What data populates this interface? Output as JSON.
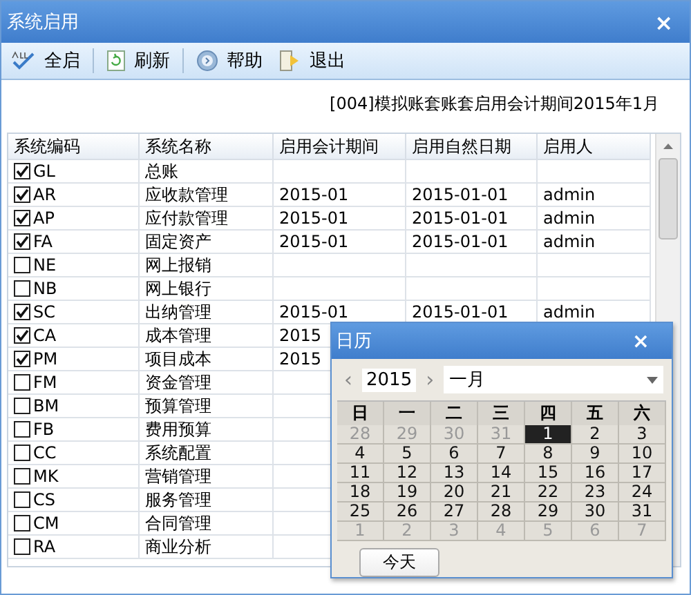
{
  "window": {
    "title": "系统启用",
    "close": "×"
  },
  "toolbar": [
    {
      "label": "全启"
    },
    {
      "label": "刷新"
    },
    {
      "label": "帮助"
    },
    {
      "label": "退出"
    }
  ],
  "info": "[004]模拟账套账套启用会计期间2015年1月",
  "table": {
    "columns": [
      "系统编码",
      "系统名称",
      "启用会计期间",
      "启用自然日期",
      "启用人"
    ],
    "rows": [
      {
        "code": "GL",
        "name": "总账",
        "checked": true
      },
      {
        "code": "AR",
        "name": "应收款管理",
        "checked": true,
        "period": "2015-01",
        "date": "2015-01-01",
        "user": "admin"
      },
      {
        "code": "AP",
        "name": "应付款管理",
        "checked": true,
        "period": "2015-01",
        "date": "2015-01-01",
        "user": "admin"
      },
      {
        "code": "FA",
        "name": "固定资产",
        "checked": true,
        "period": "2015-01",
        "date": "2015-01-01",
        "user": "admin"
      },
      {
        "code": "NE",
        "name": "网上报销",
        "checked": false
      },
      {
        "code": "NB",
        "name": "网上银行",
        "checked": false
      },
      {
        "code": "SC",
        "name": "出纳管理",
        "checked": true,
        "period": "2015-01",
        "date": "2015-01-01",
        "user": "admin"
      },
      {
        "code": "CA",
        "name": "成本管理",
        "checked": true,
        "period": "2015"
      },
      {
        "code": "PM",
        "name": "项目成本",
        "checked": true,
        "period": "2015"
      },
      {
        "code": "FM",
        "name": "资金管理",
        "checked": false
      },
      {
        "code": "BM",
        "name": "预算管理",
        "checked": false
      },
      {
        "code": "FB",
        "name": "费用预算",
        "checked": false
      },
      {
        "code": "CC",
        "name": "系统配置",
        "checked": false
      },
      {
        "code": "MK",
        "name": "营销管理",
        "checked": false
      },
      {
        "code": "CS",
        "name": "服务管理",
        "checked": false
      },
      {
        "code": "CM",
        "name": "合同管理",
        "checked": false
      },
      {
        "code": "RA",
        "name": "商业分析",
        "checked": false
      }
    ]
  },
  "calendar": {
    "title": "日历",
    "close": "×",
    "prev": "‹",
    "year": "2015",
    "next": "›",
    "month": "一月",
    "weekdays": [
      "日",
      "一",
      "二",
      "三",
      "四",
      "五",
      "六"
    ],
    "days": [
      {
        "label": "28",
        "other": true,
        "selected": false
      },
      {
        "label": "29",
        "other": true,
        "selected": false
      },
      {
        "label": "30",
        "other": true,
        "selected": false
      },
      {
        "label": "31",
        "other": true,
        "selected": false
      },
      {
        "label": "1",
        "other": false,
        "selected": true
      },
      {
        "label": "2",
        "other": false,
        "selected": false
      },
      {
        "label": "3",
        "other": false,
        "selected": false
      },
      {
        "label": "4",
        "other": false,
        "selected": false
      },
      {
        "label": "5",
        "other": false,
        "selected": false
      },
      {
        "label": "6",
        "other": false,
        "selected": false
      },
      {
        "label": "7",
        "other": false,
        "selected": false
      },
      {
        "label": "8",
        "other": false,
        "selected": false
      },
      {
        "label": "9",
        "other": false,
        "selected": false
      },
      {
        "label": "10",
        "other": false,
        "selected": false
      },
      {
        "label": "11",
        "other": false,
        "selected": false
      },
      {
        "label": "12",
        "other": false,
        "selected": false
      },
      {
        "label": "13",
        "other": false,
        "selected": false
      },
      {
        "label": "14",
        "other": false,
        "selected": false
      },
      {
        "label": "15",
        "other": false,
        "selected": false
      },
      {
        "label": "16",
        "other": false,
        "selected": false
      },
      {
        "label": "17",
        "other": false,
        "selected": false
      },
      {
        "label": "18",
        "other": false,
        "selected": false
      },
      {
        "label": "19",
        "other": false,
        "selected": false
      },
      {
        "label": "20",
        "other": false,
        "selected": false
      },
      {
        "label": "21",
        "other": false,
        "selected": false
      },
      {
        "label": "22",
        "other": false,
        "selected": false
      },
      {
        "label": "23",
        "other": false,
        "selected": false
      },
      {
        "label": "24",
        "other": false,
        "selected": false
      },
      {
        "label": "25",
        "other": false,
        "selected": false
      },
      {
        "label": "26",
        "other": false,
        "selected": false
      },
      {
        "label": "27",
        "other": false,
        "selected": false
      },
      {
        "label": "28",
        "other": false,
        "selected": false
      },
      {
        "label": "29",
        "other": false,
        "selected": false
      },
      {
        "label": "30",
        "other": false,
        "selected": false
      },
      {
        "label": "31",
        "other": false,
        "selected": false
      },
      {
        "label": "1",
        "other": true,
        "selected": false
      },
      {
        "label": "2",
        "other": true,
        "selected": false
      },
      {
        "label": "3",
        "other": true,
        "selected": false
      },
      {
        "label": "4",
        "other": true,
        "selected": false
      },
      {
        "label": "5",
        "other": true,
        "selected": false
      },
      {
        "label": "6",
        "other": true,
        "selected": false
      },
      {
        "label": "7",
        "other": true,
        "selected": false
      }
    ],
    "today_button": "今天"
  }
}
